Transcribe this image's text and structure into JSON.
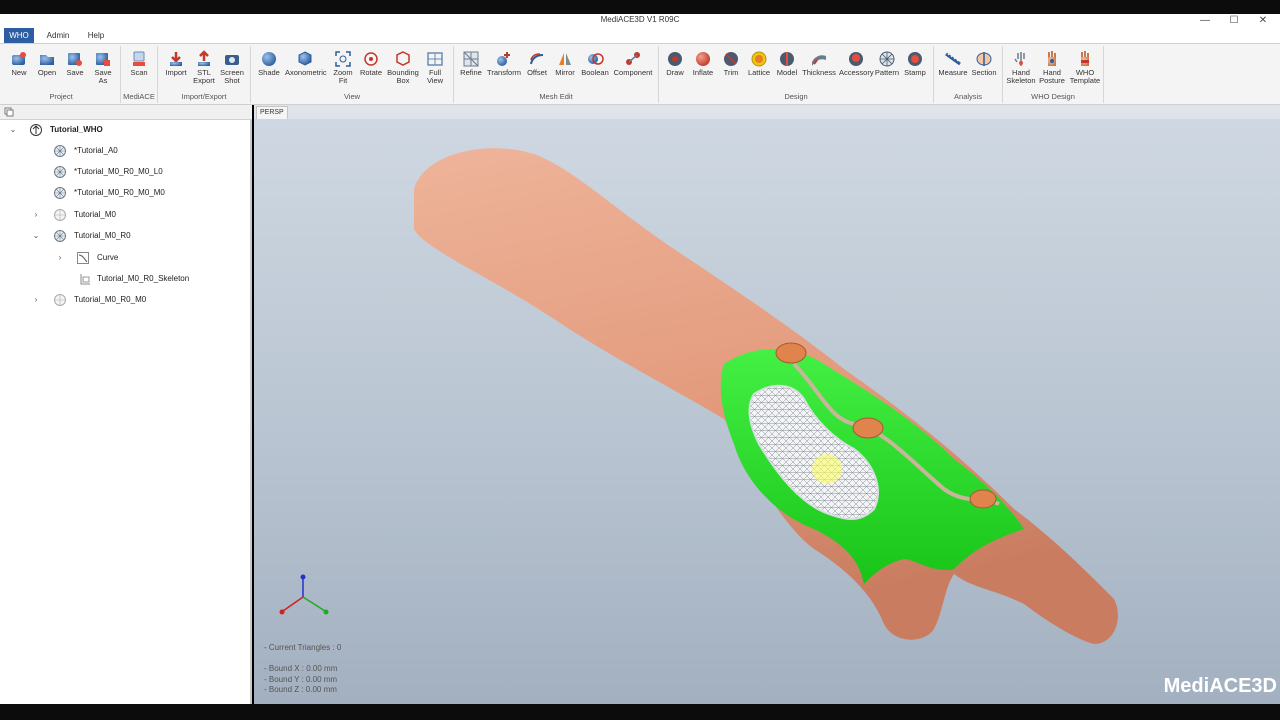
{
  "window": {
    "title": "MediACE3D V1 R09C",
    "minimize": "—",
    "maximize": "☐",
    "close": "✕"
  },
  "menu": [
    {
      "label": "WHO"
    },
    {
      "label": "Admin"
    },
    {
      "label": "Help"
    }
  ],
  "ribbon": {
    "groups": [
      {
        "label": "Project",
        "buttons": [
          {
            "label": "New",
            "icon": "new-icon"
          },
          {
            "label": "Open",
            "icon": "open-icon"
          },
          {
            "label": "Save",
            "icon": "save-icon"
          },
          {
            "label": "Save\nAs",
            "icon": "save-as-icon"
          }
        ]
      },
      {
        "label": "MediACE",
        "buttons": [
          {
            "label": "Scan",
            "icon": "scan-icon"
          }
        ]
      },
      {
        "label": "Import/Export",
        "buttons": [
          {
            "label": "Import",
            "icon": "import-icon"
          },
          {
            "label": "STL\nExport",
            "icon": "stl-export-icon"
          },
          {
            "label": "Screen\nShot",
            "icon": "camera-icon"
          }
        ]
      },
      {
        "label": "View",
        "buttons": [
          {
            "label": "Shade",
            "icon": "shade-icon"
          },
          {
            "label": "Axonometric",
            "icon": "cube-icon"
          },
          {
            "label": "Zoom\nFit",
            "icon": "zoom-fit-icon"
          },
          {
            "label": "Rotate",
            "icon": "rotate-icon"
          },
          {
            "label": "Bounding\nBox",
            "icon": "bounding-box-icon"
          },
          {
            "label": "Full\nView",
            "icon": "full-view-icon"
          }
        ]
      },
      {
        "label": "Mesh Edit",
        "buttons": [
          {
            "label": "Refine",
            "icon": "refine-icon"
          },
          {
            "label": "Transform",
            "icon": "transform-icon"
          },
          {
            "label": "Offset",
            "icon": "offset-icon"
          },
          {
            "label": "Mirror",
            "icon": "mirror-icon"
          },
          {
            "label": "Boolean",
            "icon": "boolean-icon"
          },
          {
            "label": "Component",
            "icon": "component-icon"
          }
        ]
      },
      {
        "label": "Design",
        "buttons": [
          {
            "label": "Draw",
            "icon": "draw-icon"
          },
          {
            "label": "Inflate",
            "icon": "inflate-icon"
          },
          {
            "label": "Trim",
            "icon": "trim-icon"
          },
          {
            "label": "Lattice",
            "icon": "lattice-icon"
          },
          {
            "label": "Model",
            "icon": "model-icon"
          },
          {
            "label": "Thickness",
            "icon": "thickness-icon"
          },
          {
            "label": "Accessory",
            "icon": "accessory-icon"
          },
          {
            "label": "Pattern",
            "icon": "pattern-icon"
          },
          {
            "label": "Stamp",
            "icon": "stamp-icon"
          }
        ]
      },
      {
        "label": "Analysis",
        "buttons": [
          {
            "label": "Measure",
            "icon": "measure-icon"
          },
          {
            "label": "Section",
            "icon": "section-icon"
          }
        ]
      },
      {
        "label": "WHO Design",
        "buttons": [
          {
            "label": "Hand\nSkeleton",
            "icon": "hand-skeleton-icon"
          },
          {
            "label": "Hand\nPosture",
            "icon": "hand-posture-icon"
          },
          {
            "label": "WHO\nTemplate",
            "icon": "who-template-icon"
          }
        ]
      }
    ]
  },
  "tree": [
    {
      "label": "Tutorial_WHO",
      "expander": "⌄",
      "icon": "root-icon"
    },
    {
      "label": "*Tutorial_A0",
      "expander": "",
      "icon": "mesh-icon"
    },
    {
      "label": "*Tutorial_M0_R0_M0_L0",
      "expander": "",
      "icon": "mesh-icon"
    },
    {
      "label": "*Tutorial_M0_R0_M0_M0",
      "expander": "",
      "icon": "mesh-icon"
    },
    {
      "label": "Tutorial_M0",
      "expander": "›",
      "icon": "mesh-icon"
    },
    {
      "label": "Tutorial_M0_R0",
      "expander": "⌄",
      "icon": "mesh-icon"
    },
    {
      "label": "Curve",
      "expander": "›",
      "icon": "curve-icon"
    },
    {
      "label": "Tutorial_M0_R0_Skeleton",
      "expander": "",
      "icon": "skeleton-icon"
    },
    {
      "label": "Tutorial_M0_R0_M0",
      "expander": "›",
      "icon": "mesh-icon"
    }
  ],
  "viewport": {
    "tab": "PERSP",
    "stats": {
      "triangles": "- Current Triangles : 0",
      "bound_x": "- Bound X : 0.00 mm",
      "bound_y": "- Bound Y : 0.00 mm",
      "bound_z": "- Bound Z : 0.00 mm"
    },
    "logo": "MediACE3D"
  },
  "colors": {
    "accent": "#2d5ea3",
    "splint": "#22e022",
    "skin": "#e8a48a",
    "strap": "#e0834c"
  }
}
